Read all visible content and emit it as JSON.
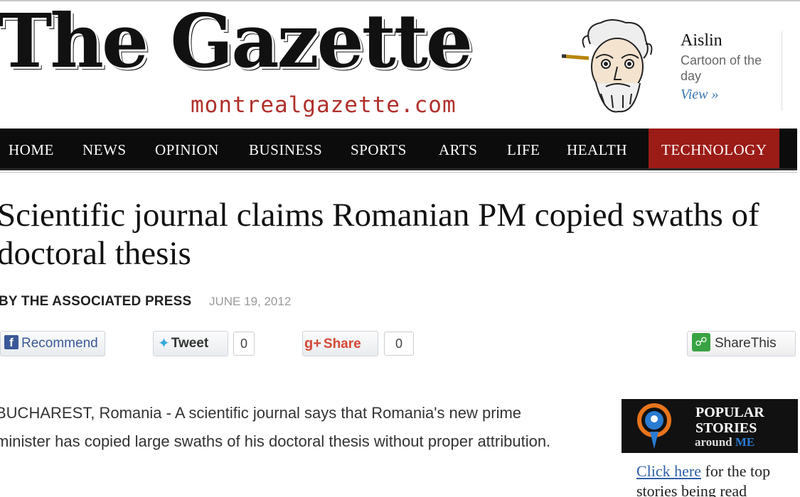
{
  "masthead": {
    "title": "The Gazette",
    "url": "montrealgazette.com"
  },
  "cartoon_promo": {
    "title": "Aislin",
    "subtitle": "Cartoon of the day",
    "link": "View »"
  },
  "nav": {
    "items": [
      {
        "label": "HOME"
      },
      {
        "label": "NEWS"
      },
      {
        "label": "OPINION"
      },
      {
        "label": "BUSINESS"
      },
      {
        "label": "SPORTS"
      },
      {
        "label": "ARTS"
      },
      {
        "label": "LIFE"
      },
      {
        "label": "HEALTH"
      },
      {
        "label": "TECHNOLOGY"
      }
    ],
    "active": "TECHNOLOGY"
  },
  "article": {
    "headline": "Scientific journal claims Romanian PM copied swaths of doctoral thesis",
    "byline": "BY THE ASSOCIATED PRESS",
    "date": "JUNE 19, 2012",
    "body": "BUCHAREST, Romania - A scientific journal says that Romania's new prime minister has copied large swaths of his doctoral thesis without proper attribution."
  },
  "social": {
    "recommend": "Recommend",
    "tweet": "Tweet",
    "tweet_count": "0",
    "share": "Share",
    "share_count": "0",
    "sharethis": "ShareThis"
  },
  "popular": {
    "title_line1": "POPULAR",
    "title_line2": "STORIES",
    "around": "around",
    "me": "ME",
    "link": "Click here",
    "text": " for the top stories being read"
  },
  "colors": {
    "nav_bg": "#0c0c0c",
    "nav_active": "#9b1b17",
    "url_red": "#b0302b",
    "link_blue": "#3a78b5"
  }
}
